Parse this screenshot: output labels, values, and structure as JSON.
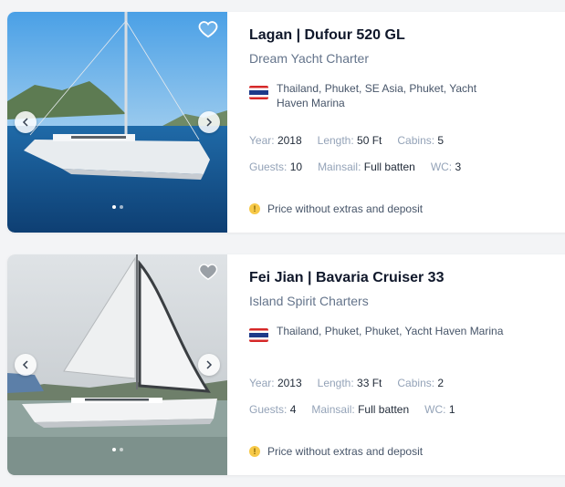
{
  "listings": [
    {
      "title": "Lagan | Dufour 520 GL",
      "company": "Dream Yacht Charter",
      "location": "Thailand, Phuket, SE Asia, Phuket, Yacht Haven Marina",
      "specs_row1": [
        {
          "label": "Year:",
          "value": "2018"
        },
        {
          "label": "Length:",
          "value": "50 Ft"
        },
        {
          "label": "Cabins:",
          "value": "5"
        }
      ],
      "specs_row2": [
        {
          "label": "Guests:",
          "value": "10"
        },
        {
          "label": "Mainsail:",
          "value": "Full batten"
        },
        {
          "label": "WC:",
          "value": "3"
        }
      ],
      "price_note": "Price without extras and deposit",
      "favorite_icon": "heart-outline-icon",
      "slide_count": 2,
      "active_slide": 1
    },
    {
      "title": "Fei Jian | Bavaria Cruiser 33",
      "company": "Island Spirit Charters",
      "location": "Thailand, Phuket, Phuket, Yacht Haven Marina",
      "specs_row1": [
        {
          "label": "Year:",
          "value": "2013"
        },
        {
          "label": "Length:",
          "value": "33 Ft"
        },
        {
          "label": "Cabins:",
          "value": "2"
        }
      ],
      "specs_row2": [
        {
          "label": "Guests:",
          "value": "4"
        },
        {
          "label": "Mainsail:",
          "value": "Full batten"
        },
        {
          "label": "WC:",
          "value": "1"
        }
      ],
      "price_note": "Price without extras and deposit",
      "favorite_icon": "heart-filled-icon",
      "slide_count": 2,
      "active_slide": 1
    }
  ],
  "colors": {
    "price_info_dot": "#f7c948",
    "flag_red": "#d62828",
    "flag_blue": "#1d3a8a"
  }
}
